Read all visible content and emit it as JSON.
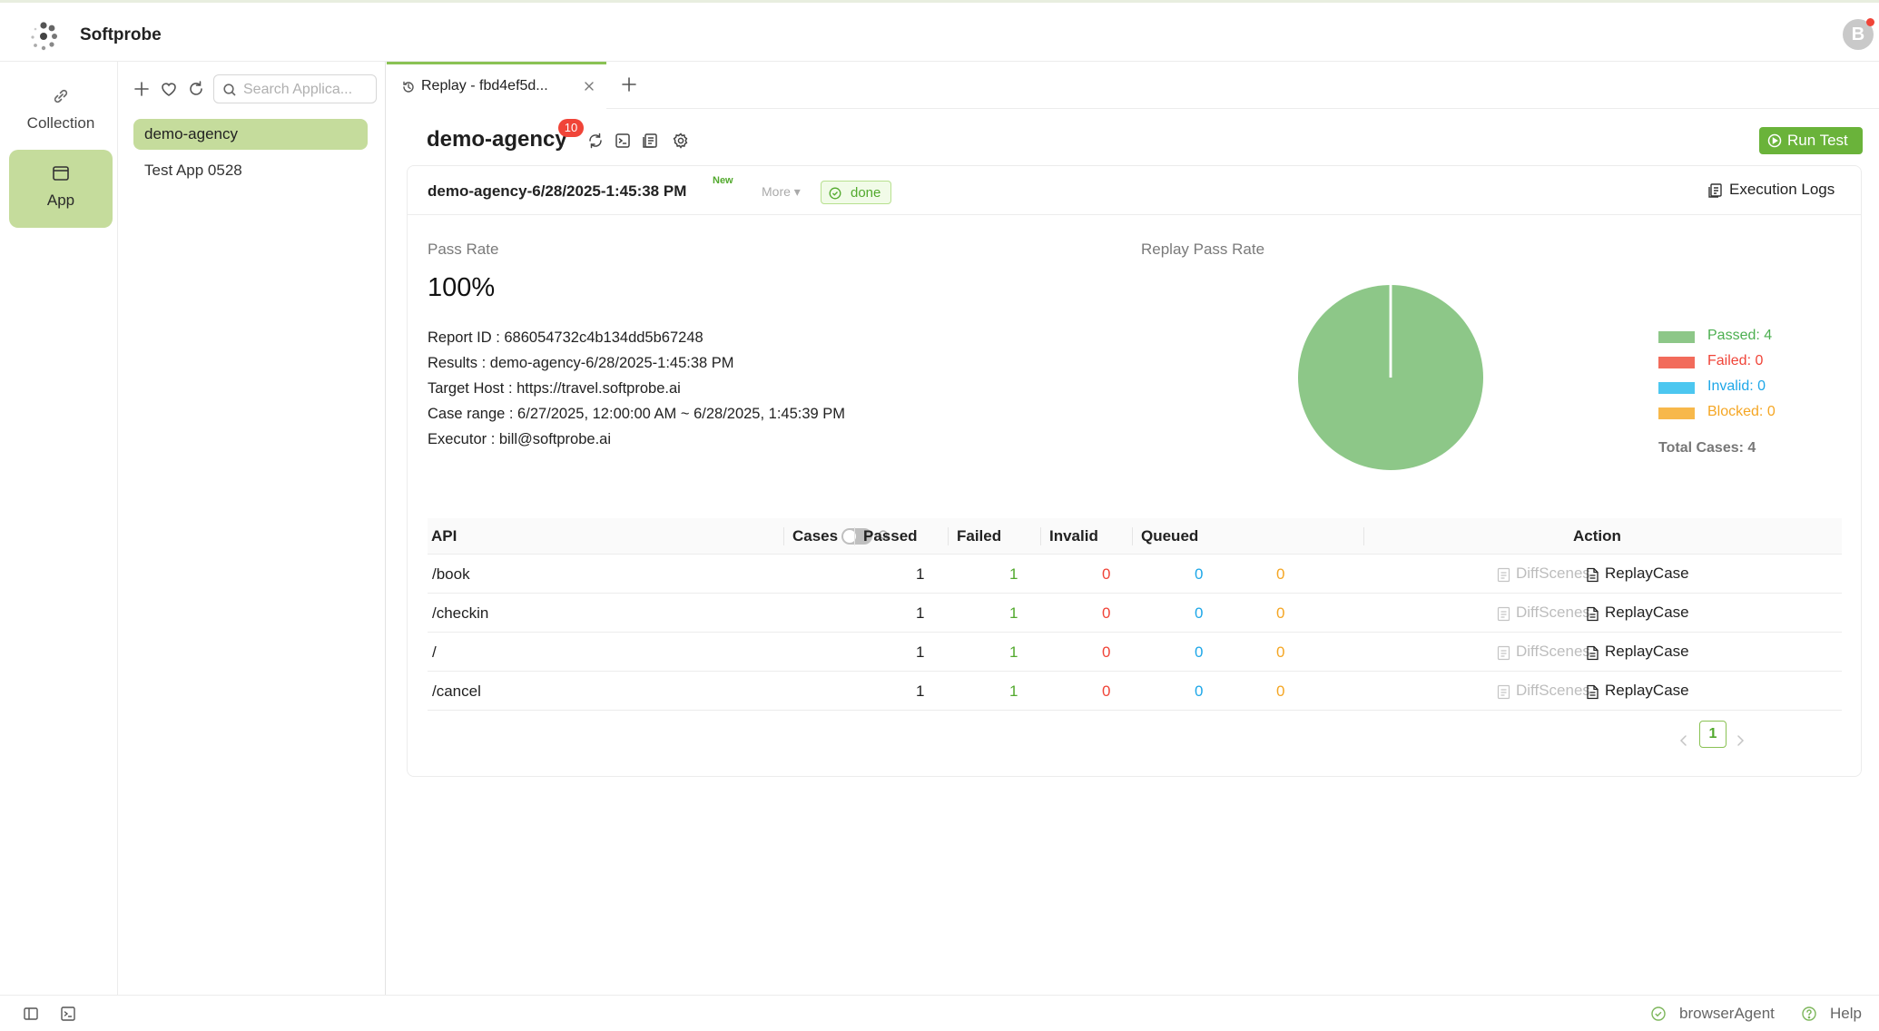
{
  "app": {
    "brand": "Softprobe",
    "avatar_initial": "B"
  },
  "rail": {
    "items": [
      {
        "label": "Collection",
        "icon": "link-icon"
      },
      {
        "label": "App",
        "icon": "app-window-icon"
      }
    ]
  },
  "apps_panel": {
    "search_placeholder": "Search Applica...",
    "items": [
      "demo-agency",
      "Test App 0528"
    ]
  },
  "tabs": [
    {
      "label": "Replay - fbd4ef5d..."
    }
  ],
  "header": {
    "title": "demo-agency",
    "badge": "10",
    "run_test": "Run Test"
  },
  "report": {
    "plan_name": "demo-agency-6/28/2025-1:45:38 PM",
    "new_tag": "New",
    "more": "More ▾",
    "status": "done",
    "execution_logs": "Execution Logs",
    "pass_rate_label": "Pass Rate",
    "pass_rate": "100%",
    "replay_pass_rate_label": "Replay Pass Rate",
    "report_id": "Report ID :  686054732c4b134dd5b67248",
    "results": "Results :  demo-agency-6/28/2025-1:45:38 PM",
    "target_host": "Target Host :  https://travel.softprobe.ai",
    "case_range": "Case range :  6/27/2025, 12:00:00 AM ~ 6/28/2025, 1:45:39 PM",
    "executor": "Executor :  bill@softprobe.ai"
  },
  "chart_data": {
    "type": "pie",
    "title": "Replay Pass Rate",
    "slices": [
      {
        "label": "Passed: 4",
        "value": 4,
        "color": "#8dc788"
      },
      {
        "label": "Failed: 0",
        "value": 0,
        "color": "#f26b5b"
      },
      {
        "label": "Invalid: 0",
        "value": 0,
        "color": "#4cc7f0"
      },
      {
        "label": "Blocked: 0",
        "value": 0,
        "color": "#f7b84b"
      }
    ],
    "legend_placement": "right",
    "total_label": "Total Cases: 4"
  },
  "legend_colors": {
    "passed": "#4caf50",
    "failed": "#f04438",
    "invalid": "#1ea7e8",
    "blocked": "#f5a623"
  },
  "table": {
    "headers": {
      "api": "API",
      "cases": "Cases",
      "passed": "Passed",
      "failed": "Failed",
      "invalid": "Invalid",
      "queued": "Queued",
      "action": "Action"
    },
    "rows": [
      {
        "api": "/book",
        "cases": "1",
        "passed": "1",
        "failed": "0",
        "invalid": "0",
        "queued": "0"
      },
      {
        "api": "/checkin",
        "cases": "1",
        "passed": "1",
        "failed": "0",
        "invalid": "0",
        "queued": "0"
      },
      {
        "api": "/",
        "cases": "1",
        "passed": "1",
        "failed": "0",
        "invalid": "0",
        "queued": "0"
      },
      {
        "api": "/cancel",
        "cases": "1",
        "passed": "1",
        "failed": "0",
        "invalid": "0",
        "queued": "0"
      }
    ],
    "diff_label": "DiffScenes",
    "replay_label": "ReplayCase",
    "page": "1"
  },
  "bottom": {
    "agent": "browserAgent",
    "help": "Help"
  }
}
